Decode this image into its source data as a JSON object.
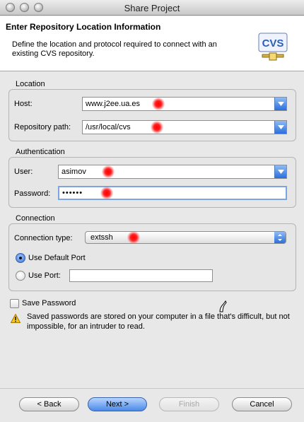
{
  "window": {
    "title": "Share Project"
  },
  "header": {
    "title": "Enter Repository Location Information",
    "description": "Define the location and protocol required to connect with an existing CVS repository.",
    "logo_text": "CVS"
  },
  "location": {
    "group_label": "Location",
    "host_label": "Host:",
    "host_value": "www.j2ee.ua.es",
    "path_label": "Repository path:",
    "path_value": "/usr/local/cvs"
  },
  "authentication": {
    "group_label": "Authentication",
    "user_label": "User:",
    "user_value": "asimov",
    "password_label": "Password:",
    "password_value": "••••••"
  },
  "connection": {
    "group_label": "Connection",
    "type_label": "Connection type:",
    "type_value": "extssh",
    "default_port_label": "Use Default Port",
    "use_port_label": "Use Port:",
    "port_value": ""
  },
  "save_password": {
    "label": "Save Password",
    "warning": "Saved passwords are stored on your computer in a file that's difficult, but not impossible, for an intruder to read."
  },
  "buttons": {
    "back": "< Back",
    "next": "Next >",
    "finish": "Finish",
    "cancel": "Cancel"
  },
  "colors": {
    "accent": "#2a6fdc",
    "highlight_marker": "#ff0000"
  }
}
